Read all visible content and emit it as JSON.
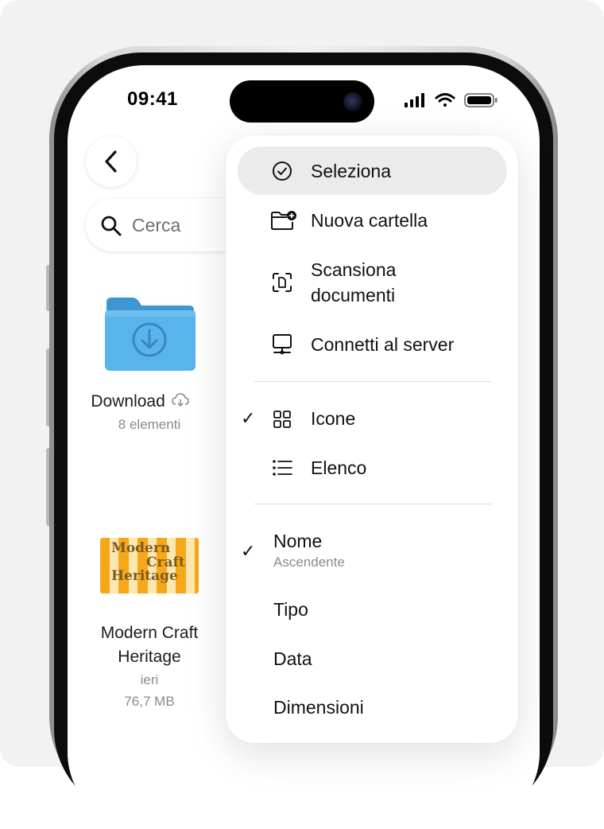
{
  "status_bar": {
    "time": "09:41"
  },
  "nav": {
    "back_icon": "chevron-left-icon"
  },
  "search": {
    "placeholder": "Cerca",
    "icon": "magnifier-icon"
  },
  "files": [
    {
      "name": "Download",
      "subtitle": "8 elementi",
      "icon": "folder-download-icon",
      "cloud_icon": "icloud-download-icon"
    },
    {
      "name_line1": "Modern Craft",
      "name_line2": "Heritage",
      "date": "ieri",
      "size": "76,7 MB",
      "thumb_text": [
        "Modern",
        "Craft",
        "Heritage"
      ]
    }
  ],
  "menu": {
    "actions": [
      {
        "label": "Seleziona",
        "icon": "checkmark-circle-icon"
      },
      {
        "label": "Nuova cartella",
        "icon": "folder-badge-plus-icon"
      },
      {
        "label_line1": "Scansiona",
        "label_line2": "documenti",
        "icon": "document-viewfinder-icon"
      },
      {
        "label": "Connetti al server",
        "icon": "server-display-icon"
      }
    ],
    "views": [
      {
        "label": "Icone",
        "icon": "grid-icon",
        "checked": true
      },
      {
        "label": "Elenco",
        "icon": "list-icon",
        "checked": false
      }
    ],
    "sort": [
      {
        "label": "Nome",
        "sublabel": "Ascendente",
        "checked": true
      },
      {
        "label": "Tipo",
        "checked": false
      },
      {
        "label": "Data",
        "checked": false
      },
      {
        "label": "Dimensioni",
        "checked": false
      }
    ],
    "check_glyph": "✓"
  },
  "colors": {
    "folder": "#5ab4ec",
    "folder_dark": "#3e96d3",
    "thumb": "#f6a81b",
    "highlight": "#ebebeb"
  }
}
